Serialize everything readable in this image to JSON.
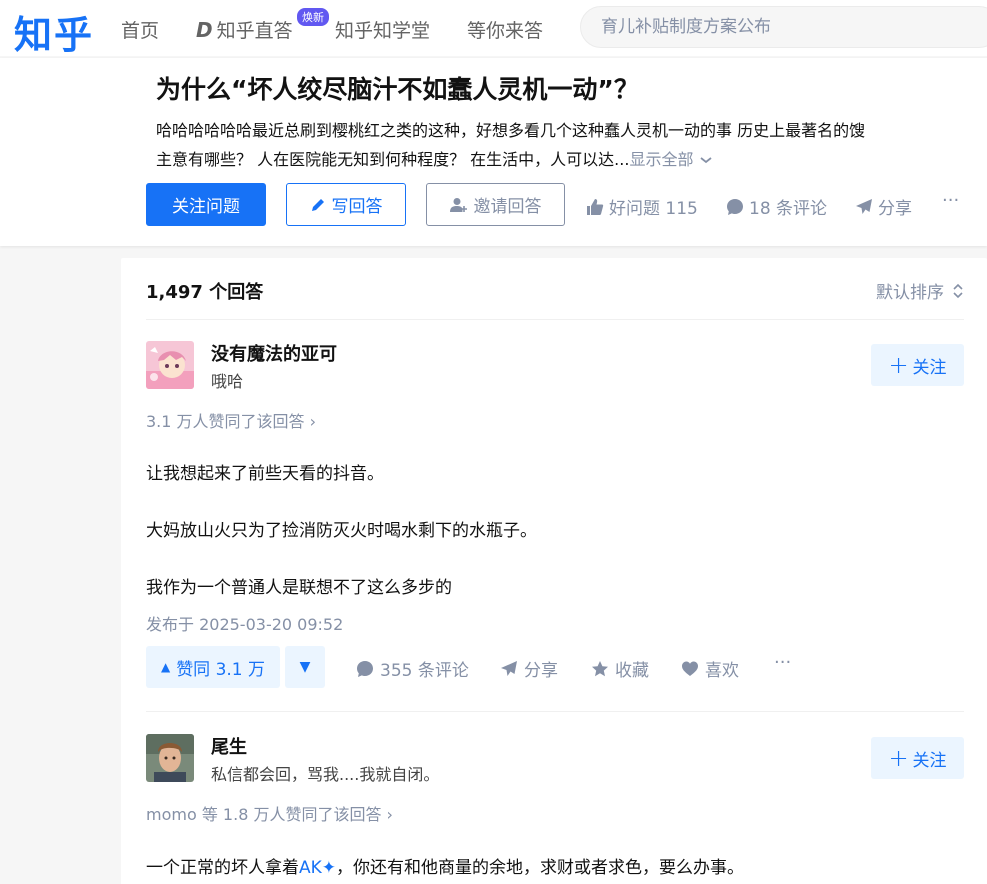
{
  "nav": {
    "logo": "知乎",
    "home": "首页",
    "live": "知乎直答",
    "live_badge": "焕新",
    "school": "知乎知学堂",
    "answer_wait": "等你来答",
    "search_placeholder": "育儿补贴制度方案公布"
  },
  "question": {
    "title": "为什么“坏人绞尽脑汁不如蠢人灵机一动”？",
    "detail_line1": "哈哈哈哈哈哈最近总刷到樱桃红之类的这种，好想多看几个这种蠢人灵机一动的事 历史上最著名的馊",
    "detail_line2": "主意有哪些？ 人在医院能无知到何种程度？ 在生活中，人可以达...",
    "show_all": "显示全部",
    "follow_label": "关注问题",
    "write_label": "写回答",
    "invite_label": "邀请回答",
    "good_question": "好问题 115",
    "comments": "18 条评论",
    "share": "分享",
    "more": "···"
  },
  "answers_header": {
    "count": "1,497 个回答",
    "sort": "默认排序"
  },
  "answers": [
    {
      "author": "没有魔法的亚可",
      "bio": "哦哈",
      "follow": "关注",
      "voters": "3.1 万人赞同了该回答 ›",
      "paragraphs": [
        "让我想起来了前些天看的抖音。",
        "大妈放山火只为了捡消防灭火时喝水剩下的水瓶子。",
        "我作为一个普通人是联想不了这么多步的"
      ],
      "publish_time": "发布于 2025-03-20 09:52",
      "vote_up": "赞同 3.1 万",
      "comments": "355 条评论",
      "share": "分享",
      "favorite": "收藏",
      "like": "喜欢",
      "more": "···"
    },
    {
      "author": "尾生",
      "bio": "私信都会回，骂我....我就自闭。",
      "follow": "关注",
      "voters": "momo 等 1.8 万人赞同了该回答 ›",
      "para_before": "一个正常的坏人拿着",
      "para_link": "AK✦",
      "para_after": "，你还有和他商量的余地，求财或者求色，要么办事。"
    }
  ]
}
